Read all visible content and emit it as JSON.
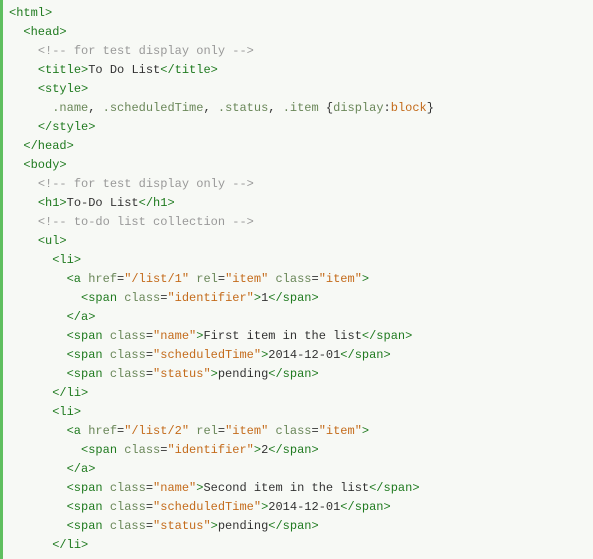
{
  "lines": [
    {
      "indent": 0,
      "parts": [
        {
          "c": "tag",
          "t": "<html>"
        }
      ]
    },
    {
      "indent": 1,
      "parts": [
        {
          "c": "tag",
          "t": "<head>"
        }
      ]
    },
    {
      "indent": 2,
      "parts": [
        {
          "c": "cmt",
          "t": "<!-- for test display only -->"
        }
      ]
    },
    {
      "indent": 2,
      "parts": [
        {
          "c": "tag",
          "t": "<title>"
        },
        {
          "c": "txt",
          "t": "To Do List"
        },
        {
          "c": "tag",
          "t": "</title>"
        }
      ]
    },
    {
      "indent": 2,
      "parts": [
        {
          "c": "tag",
          "t": "<style>"
        }
      ]
    },
    {
      "indent": 3,
      "parts": [
        {
          "c": "prop",
          "t": ".name"
        },
        {
          "c": "txt",
          "t": ", "
        },
        {
          "c": "prop",
          "t": ".scheduledTime"
        },
        {
          "c": "txt",
          "t": ", "
        },
        {
          "c": "prop",
          "t": ".status"
        },
        {
          "c": "txt",
          "t": ", "
        },
        {
          "c": "prop",
          "t": ".item"
        },
        {
          "c": "txt",
          "t": " "
        },
        {
          "c": "brace",
          "t": "{"
        },
        {
          "c": "prop",
          "t": "display"
        },
        {
          "c": "txt",
          "t": ":"
        },
        {
          "c": "cssval",
          "t": "block"
        },
        {
          "c": "brace",
          "t": "}"
        }
      ]
    },
    {
      "indent": 2,
      "parts": [
        {
          "c": "tag",
          "t": "</style>"
        }
      ]
    },
    {
      "indent": 1,
      "parts": [
        {
          "c": "tag",
          "t": "</head>"
        }
      ]
    },
    {
      "indent": 1,
      "parts": [
        {
          "c": "tag",
          "t": "<body>"
        }
      ]
    },
    {
      "indent": 2,
      "parts": [
        {
          "c": "cmt",
          "t": "<!-- for test display only -->"
        }
      ]
    },
    {
      "indent": 2,
      "parts": [
        {
          "c": "tag",
          "t": "<h1>"
        },
        {
          "c": "txt",
          "t": "To-Do List"
        },
        {
          "c": "tag",
          "t": "</h1>"
        }
      ]
    },
    {
      "indent": 2,
      "parts": [
        {
          "c": "cmt",
          "t": "<!-- to-do list collection -->"
        }
      ]
    },
    {
      "indent": 2,
      "parts": [
        {
          "c": "tag",
          "t": "<ul>"
        }
      ]
    },
    {
      "indent": 3,
      "parts": [
        {
          "c": "tag",
          "t": "<li>"
        }
      ]
    },
    {
      "indent": 4,
      "parts": [
        {
          "c": "tag",
          "t": "<a "
        },
        {
          "c": "attr",
          "t": "href"
        },
        {
          "c": "eq",
          "t": "="
        },
        {
          "c": "val",
          "t": "\"/list/1\""
        },
        {
          "c": "tag",
          "t": " "
        },
        {
          "c": "attr",
          "t": "rel"
        },
        {
          "c": "eq",
          "t": "="
        },
        {
          "c": "val",
          "t": "\"item\""
        },
        {
          "c": "tag",
          "t": " "
        },
        {
          "c": "attr",
          "t": "class"
        },
        {
          "c": "eq",
          "t": "="
        },
        {
          "c": "val",
          "t": "\"item\""
        },
        {
          "c": "tag",
          "t": ">"
        }
      ]
    },
    {
      "indent": 5,
      "parts": [
        {
          "c": "tag",
          "t": "<span "
        },
        {
          "c": "attr",
          "t": "class"
        },
        {
          "c": "eq",
          "t": "="
        },
        {
          "c": "val",
          "t": "\"identifier\""
        },
        {
          "c": "tag",
          "t": ">"
        },
        {
          "c": "txt",
          "t": "1"
        },
        {
          "c": "tag",
          "t": "</span>"
        }
      ]
    },
    {
      "indent": 4,
      "parts": [
        {
          "c": "tag",
          "t": "</a>"
        }
      ]
    },
    {
      "indent": 4,
      "parts": [
        {
          "c": "tag",
          "t": "<span "
        },
        {
          "c": "attr",
          "t": "class"
        },
        {
          "c": "eq",
          "t": "="
        },
        {
          "c": "val",
          "t": "\"name\""
        },
        {
          "c": "tag",
          "t": ">"
        },
        {
          "c": "txt",
          "t": "First item in the list"
        },
        {
          "c": "tag",
          "t": "</span>"
        }
      ]
    },
    {
      "indent": 4,
      "parts": [
        {
          "c": "tag",
          "t": "<span "
        },
        {
          "c": "attr",
          "t": "class"
        },
        {
          "c": "eq",
          "t": "="
        },
        {
          "c": "val",
          "t": "\"scheduledTime\""
        },
        {
          "c": "tag",
          "t": ">"
        },
        {
          "c": "txt",
          "t": "2014-12-01"
        },
        {
          "c": "tag",
          "t": "</span>"
        }
      ]
    },
    {
      "indent": 4,
      "parts": [
        {
          "c": "tag",
          "t": "<span "
        },
        {
          "c": "attr",
          "t": "class"
        },
        {
          "c": "eq",
          "t": "="
        },
        {
          "c": "val",
          "t": "\"status\""
        },
        {
          "c": "tag",
          "t": ">"
        },
        {
          "c": "txt",
          "t": "pending"
        },
        {
          "c": "tag",
          "t": "</span>"
        }
      ]
    },
    {
      "indent": 3,
      "parts": [
        {
          "c": "tag",
          "t": "</li>"
        }
      ]
    },
    {
      "indent": 3,
      "parts": [
        {
          "c": "tag",
          "t": "<li>"
        }
      ]
    },
    {
      "indent": 4,
      "parts": [
        {
          "c": "tag",
          "t": "<a "
        },
        {
          "c": "attr",
          "t": "href"
        },
        {
          "c": "eq",
          "t": "="
        },
        {
          "c": "val",
          "t": "\"/list/2\""
        },
        {
          "c": "tag",
          "t": " "
        },
        {
          "c": "attr",
          "t": "rel"
        },
        {
          "c": "eq",
          "t": "="
        },
        {
          "c": "val",
          "t": "\"item\""
        },
        {
          "c": "tag",
          "t": " "
        },
        {
          "c": "attr",
          "t": "class"
        },
        {
          "c": "eq",
          "t": "="
        },
        {
          "c": "val",
          "t": "\"item\""
        },
        {
          "c": "tag",
          "t": ">"
        }
      ]
    },
    {
      "indent": 5,
      "parts": [
        {
          "c": "tag",
          "t": "<span "
        },
        {
          "c": "attr",
          "t": "class"
        },
        {
          "c": "eq",
          "t": "="
        },
        {
          "c": "val",
          "t": "\"identifier\""
        },
        {
          "c": "tag",
          "t": ">"
        },
        {
          "c": "txt",
          "t": "2"
        },
        {
          "c": "tag",
          "t": "</span>"
        }
      ]
    },
    {
      "indent": 4,
      "parts": [
        {
          "c": "tag",
          "t": "</a>"
        }
      ]
    },
    {
      "indent": 4,
      "parts": [
        {
          "c": "tag",
          "t": "<span "
        },
        {
          "c": "attr",
          "t": "class"
        },
        {
          "c": "eq",
          "t": "="
        },
        {
          "c": "val",
          "t": "\"name\""
        },
        {
          "c": "tag",
          "t": ">"
        },
        {
          "c": "txt",
          "t": "Second item in the list"
        },
        {
          "c": "tag",
          "t": "</span>"
        }
      ]
    },
    {
      "indent": 4,
      "parts": [
        {
          "c": "tag",
          "t": "<span "
        },
        {
          "c": "attr",
          "t": "class"
        },
        {
          "c": "eq",
          "t": "="
        },
        {
          "c": "val",
          "t": "\"scheduledTime\""
        },
        {
          "c": "tag",
          "t": ">"
        },
        {
          "c": "txt",
          "t": "2014-12-01"
        },
        {
          "c": "tag",
          "t": "</span>"
        }
      ]
    },
    {
      "indent": 4,
      "parts": [
        {
          "c": "tag",
          "t": "<span "
        },
        {
          "c": "attr",
          "t": "class"
        },
        {
          "c": "eq",
          "t": "="
        },
        {
          "c": "val",
          "t": "\"status\""
        },
        {
          "c": "tag",
          "t": ">"
        },
        {
          "c": "txt",
          "t": "pending"
        },
        {
          "c": "tag",
          "t": "</span>"
        }
      ]
    },
    {
      "indent": 3,
      "parts": [
        {
          "c": "tag",
          "t": "</li>"
        }
      ]
    }
  ]
}
